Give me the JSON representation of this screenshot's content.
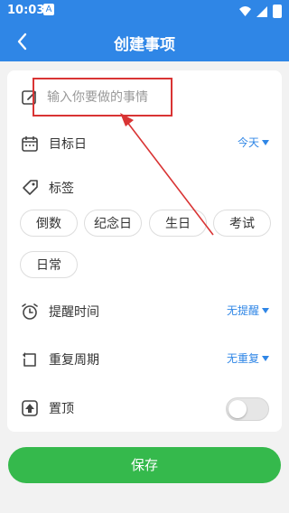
{
  "status_bar": {
    "time": "10:03",
    "a_icon": "A"
  },
  "header": {
    "title": "创建事项"
  },
  "thing_input": {
    "placeholder": "输入你要做的事情",
    "value": ""
  },
  "target_day": {
    "label": "目标日",
    "value": "今天"
  },
  "tags": {
    "label": "标签",
    "chips": [
      "倒数",
      "纪念日",
      "生日",
      "考试",
      "日常"
    ]
  },
  "reminder": {
    "label": "提醒时间",
    "value": "无提醒"
  },
  "repeat": {
    "label": "重复周期",
    "value": "无重复"
  },
  "pin": {
    "label": "置顶",
    "enabled": false
  },
  "save_button": {
    "label": "保存"
  },
  "colors": {
    "primary": "#2f86e6",
    "save": "#35b94c",
    "annotation": "#d93434"
  }
}
